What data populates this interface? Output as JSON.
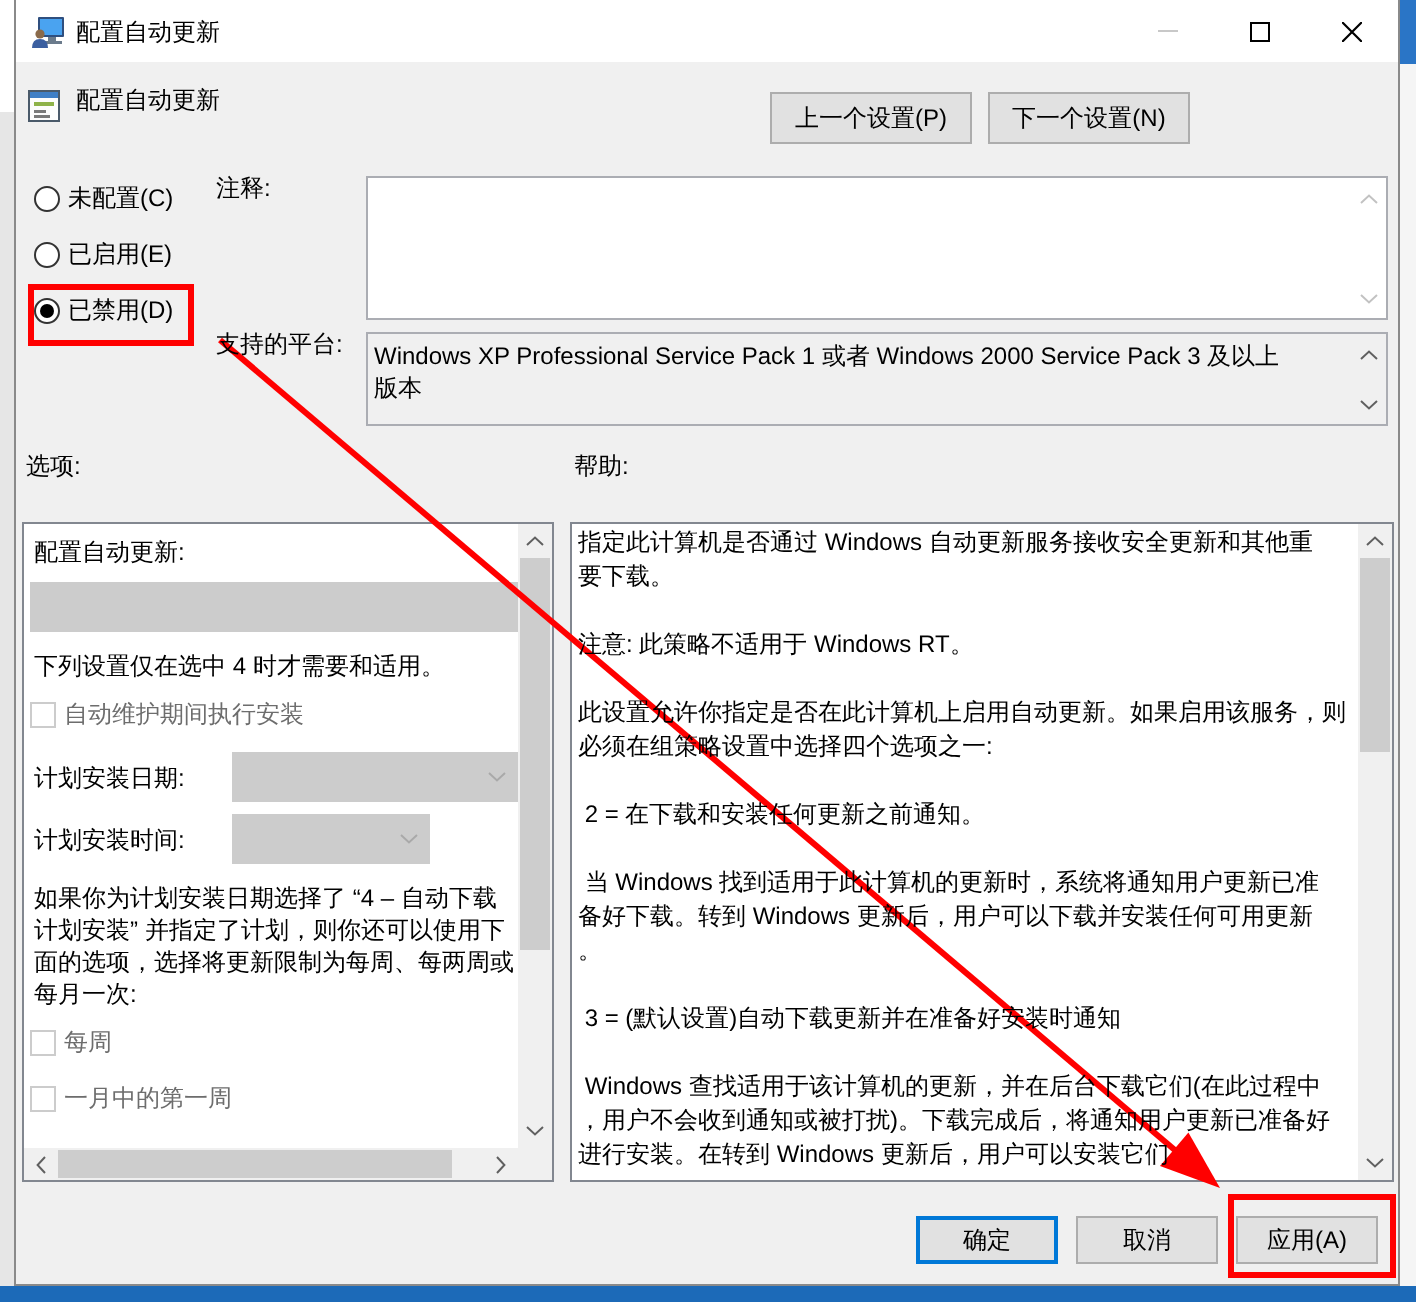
{
  "window": {
    "title": "配置自动更新",
    "caption_buttons": [
      {
        "kind": "minimize",
        "disabled": true
      },
      {
        "kind": "maximize",
        "disabled": false
      },
      {
        "kind": "close",
        "disabled": false
      }
    ]
  },
  "header": {
    "title": "配置自动更新",
    "buttons": [
      "上一个设置(P)",
      "下一个设置(N)"
    ]
  },
  "state_options": [
    {
      "label": "未配置(C)",
      "selected": false,
      "highlighted": false
    },
    {
      "label": "已启用(E)",
      "selected": false,
      "highlighted": false
    },
    {
      "label": "已禁用(D)",
      "selected": true,
      "highlighted": true
    }
  ],
  "comment": {
    "label": "注释:"
  },
  "platform": {
    "label": "支持的平台:",
    "lines": [
      "Windows XP Professional Service Pack 1 或者 Windows 2000 Service Pack 3 及以上",
      "版本"
    ]
  },
  "options": {
    "label": "选项:",
    "items": [
      {
        "kind": "text",
        "text": "配置自动更新:"
      },
      {
        "kind": "dropdown",
        "disabled": true
      },
      {
        "kind": "text",
        "text": "下列设置仅在选中 4 时才需要和适用。"
      },
      {
        "kind": "checkbox",
        "label": "自动维护期间执行安装",
        "checked": false,
        "disabled": true
      },
      {
        "kind": "labeled_dropdown",
        "label": "计划安装日期:",
        "disabled": true
      },
      {
        "kind": "labeled_dropdown",
        "label": "计划安装时间:",
        "disabled": true
      },
      {
        "kind": "paragraph",
        "lines": [
          "如果你为计划安装日期选择了 “4 – 自动下载",
          "计划安装” 并指定了计划，则你还可以使用下",
          "面的选项，选择将更新限制为每周、每两周或",
          "每月一次:"
        ]
      },
      {
        "kind": "checkbox",
        "label": "每周",
        "checked": false,
        "disabled": true
      },
      {
        "kind": "checkbox",
        "label": "一月中的第一周",
        "checked": false,
        "disabled": true
      }
    ]
  },
  "help": {
    "label": "帮助:",
    "paragraphs": [
      {
        "lines": [
          "指定此计算机是否通过 Windows 自动更新服务接收安全更新和其他重",
          "要下载。"
        ]
      },
      {
        "lines": [
          "注意: 此策略不适用于 Windows RT。"
        ]
      },
      {
        "lines": [
          "此设置允许你指定是否在此计算机上启用自动更新。如果启用该服务，则",
          "必须在组策略设置中选择四个选项之一:"
        ]
      },
      {
        "lines": [
          " 2 = 在下载和安装任何更新之前通知。"
        ]
      },
      {
        "lines": [
          " 当 Windows 找到适用于此计算机的更新时，系统将通知用户更新已准",
          "备好下载。转到 Windows 更新后，用户可以下载并安装任何可用更新",
          "。"
        ]
      },
      {
        "lines": [
          " 3 = (默认设置)自动下载更新并在准备好安装时通知"
        ]
      },
      {
        "lines": [
          " Windows 查找适用于该计算机的更新，并在后台下载它们(在此过程中",
          "，用户不会收到通知或被打扰)。下载完成后，将通知用户更新已准备好",
          "进行安装。在转到 Windows 更新后，用户可以安装它们"
        ]
      }
    ]
  },
  "footer": {
    "buttons": [
      {
        "label": "确定",
        "focused": true,
        "highlighted": false
      },
      {
        "label": "取消",
        "focused": false,
        "highlighted": false
      },
      {
        "label": "应用(A)",
        "focused": false,
        "highlighted": true
      }
    ]
  }
}
